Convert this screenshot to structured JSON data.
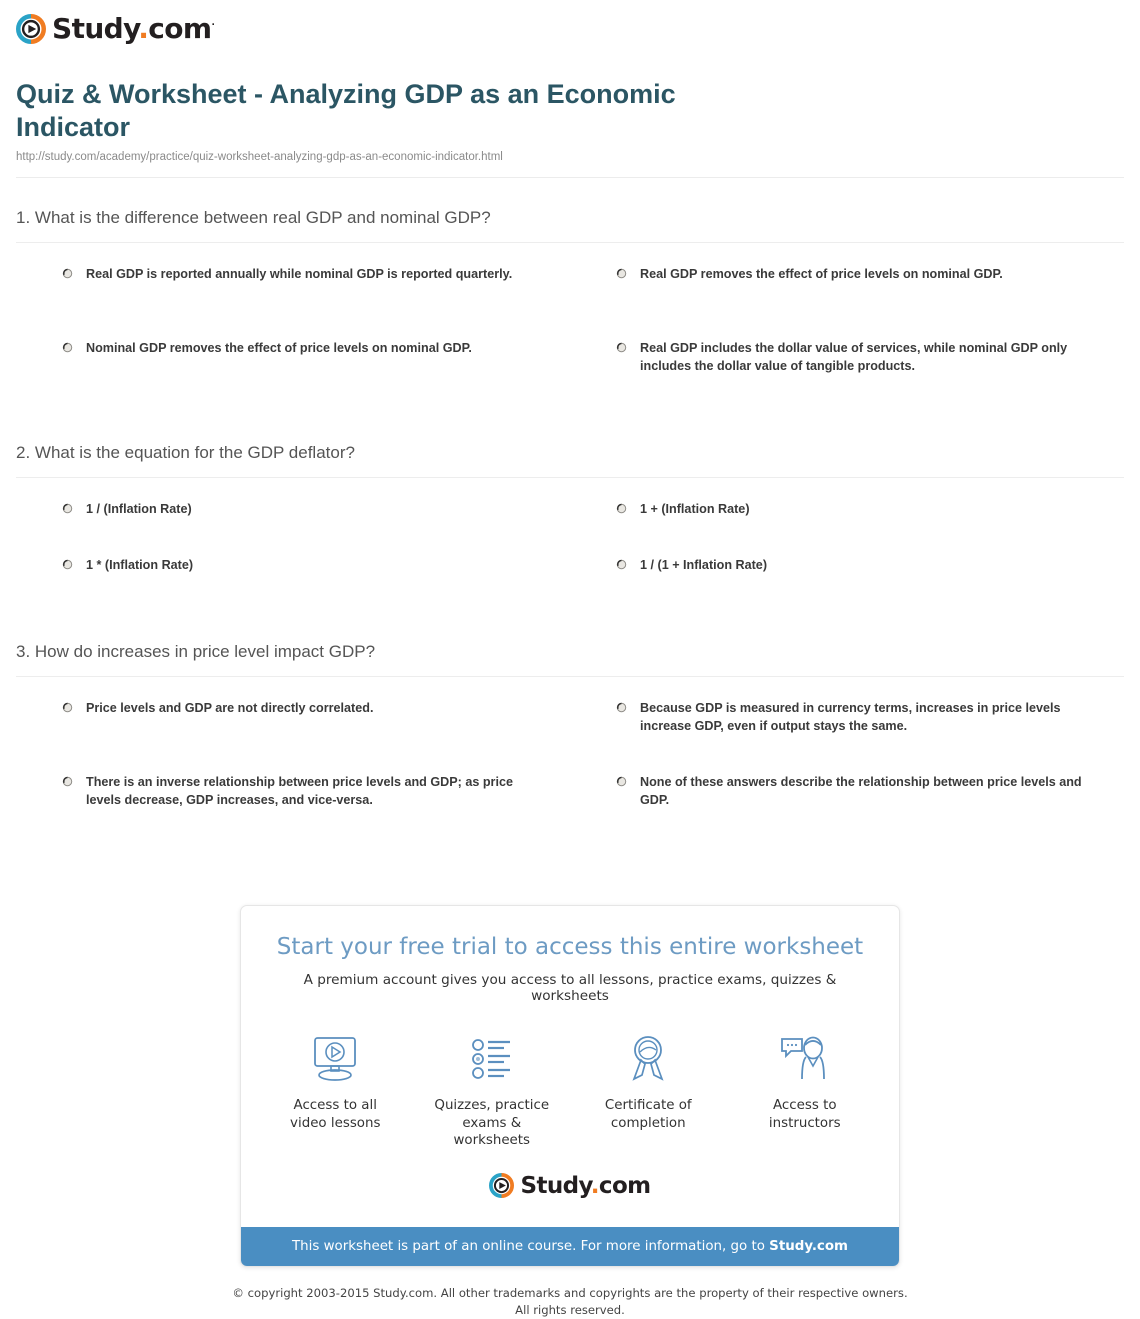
{
  "brand": {
    "name_main": "Study",
    "name_dot": ".",
    "name_tld": "com",
    "trademark": "·",
    "logo_icon": "study-play-circle-icon",
    "colors": {
      "teal": "#2aa3c7",
      "orange": "#f07c22",
      "text": "#231f20"
    }
  },
  "header": {
    "title": "Quiz & Worksheet - Analyzing GDP as an Economic Indicator",
    "url": "http://study.com/academy/practice/quiz-worksheet-analyzing-gdp-as-an-economic-indicator.html",
    "title_color": "#2b5664"
  },
  "questions": [
    {
      "number": "1.",
      "prompt": "1. What is the difference between real GDP and nominal GDP?",
      "options": [
        "Real GDP is reported annually while nominal GDP is reported quarterly.",
        "Nominal GDP removes the effect of price levels on nominal GDP.",
        "Real GDP removes the effect of price levels on nominal GDP.",
        "Real GDP includes the dollar value of services, while nominal GDP only includes the dollar value of tangible products."
      ]
    },
    {
      "number": "2.",
      "prompt": "2. What is the equation for the GDP deflator?",
      "options": [
        "1 / (Inflation Rate)",
        "1 + (Inflation Rate)",
        "1 * (Inflation Rate)",
        "1 / (1 + Inflation Rate)"
      ]
    },
    {
      "number": "3.",
      "prompt": "3. How do increases in price level impact GDP?",
      "options": [
        "Price levels and GDP are not directly correlated.",
        "Because GDP is measured in currency terms, increases in price levels increase GDP, even if output stays the same.",
        "There is an inverse relationship between price levels and GDP; as price levels decrease, GDP increases, and vice-versa.",
        "None of these answers describe the relationship between price levels and GDP."
      ]
    }
  ],
  "promo": {
    "heading": "Start your free trial to access this entire worksheet",
    "subheading": "A premium account gives you access to all lessons, practice exams, quizzes & worksheets",
    "heading_color": "#6d9bc3",
    "perks": [
      {
        "icon": "monitor-play-icon",
        "label": "Access to all video lessons"
      },
      {
        "icon": "quiz-list-icon",
        "label": "Quizzes, practice exams & worksheets"
      },
      {
        "icon": "award-ribbon-icon",
        "label": "Certificate of completion"
      },
      {
        "icon": "instructor-chat-icon",
        "label": "Access to instructors"
      }
    ],
    "banner_text": "This worksheet is part of an online course. For more information, go to ",
    "banner_link": "Study.com",
    "banner_color": "#4a8ec2"
  },
  "footer": {
    "line1": "© copyright 2003-2015 Study.com. All other trademarks and copyrights are the property of their respective owners.",
    "line2": "All rights reserved."
  }
}
